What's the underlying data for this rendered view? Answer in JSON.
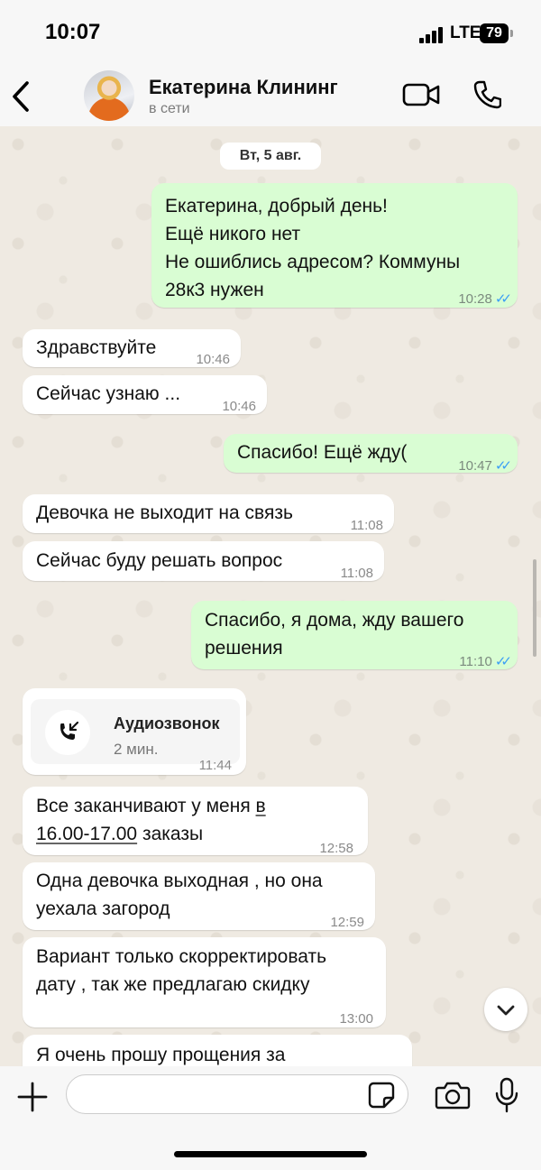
{
  "status_bar": {
    "time": "10:07",
    "network": "LTE",
    "battery": "79"
  },
  "header": {
    "contact_name": "Екатерина Клининг",
    "contact_status": "в сети"
  },
  "chat": {
    "date_label": "Вт, 5 авг.",
    "messages": [
      {
        "direction": "out",
        "lines": [
          "Екатерина, добрый день!",
          "Ещё никого нет",
          "Не ошиблись адресом? Коммуны",
          "28к3 нужен"
        ],
        "time": "10:28",
        "read": true
      },
      {
        "direction": "in",
        "lines": [
          "Здравствуйте"
        ],
        "time": "10:46"
      },
      {
        "direction": "in",
        "lines": [
          "Сейчас узнаю ..."
        ],
        "time": "10:46"
      },
      {
        "direction": "out",
        "lines": [
          "Спасибо! Ещё жду("
        ],
        "time": "10:47",
        "read": true
      },
      {
        "direction": "in",
        "lines": [
          "Девочка не выходит на связь"
        ],
        "time": "11:08"
      },
      {
        "direction": "in",
        "lines": [
          "Сейчас буду решать вопрос"
        ],
        "time": "11:08"
      },
      {
        "direction": "out",
        "lines": [
          "Спасибо, я дома, жду вашего",
          "решения"
        ],
        "time": "11:10",
        "read": true
      },
      {
        "direction": "in",
        "type": "call",
        "call_title": "Аудиозвонок",
        "call_duration": "2 мин.",
        "time": "11:44"
      },
      {
        "direction": "in",
        "line1_prefix": "Все заканчивают у меня ",
        "line1_link": "в",
        "line2_link": "16.00-17.00",
        "line2_suffix": " заказы",
        "time": "12:58"
      },
      {
        "direction": "in",
        "lines": [
          "Одна девочка выходная , но она",
          "уехала загород"
        ],
        "time": "12:59"
      },
      {
        "direction": "in",
        "lines": [
          "Вариант только скорректировать",
          "дату , так же предлагаю скидку"
        ],
        "time": "13:00"
      },
      {
        "direction": "in",
        "lines": [
          "Я очень прошу прощения за"
        ]
      }
    ]
  },
  "input": {
    "value": "",
    "placeholder": ""
  },
  "icons": {
    "back": "chevron-left-icon",
    "video": "video-camera-icon",
    "phone": "phone-icon",
    "call": "incoming-call-icon",
    "scroll": "chevron-down-icon",
    "plus": "plus-icon",
    "sticker": "sticker-icon",
    "camera": "camera-icon",
    "mic": "microphone-icon"
  },
  "colors": {
    "outgoing_bubble": "#d9fdd3",
    "incoming_bubble": "#ffffff",
    "read_ticks": "#3b9ff5",
    "chat_background": "#efeae2"
  }
}
